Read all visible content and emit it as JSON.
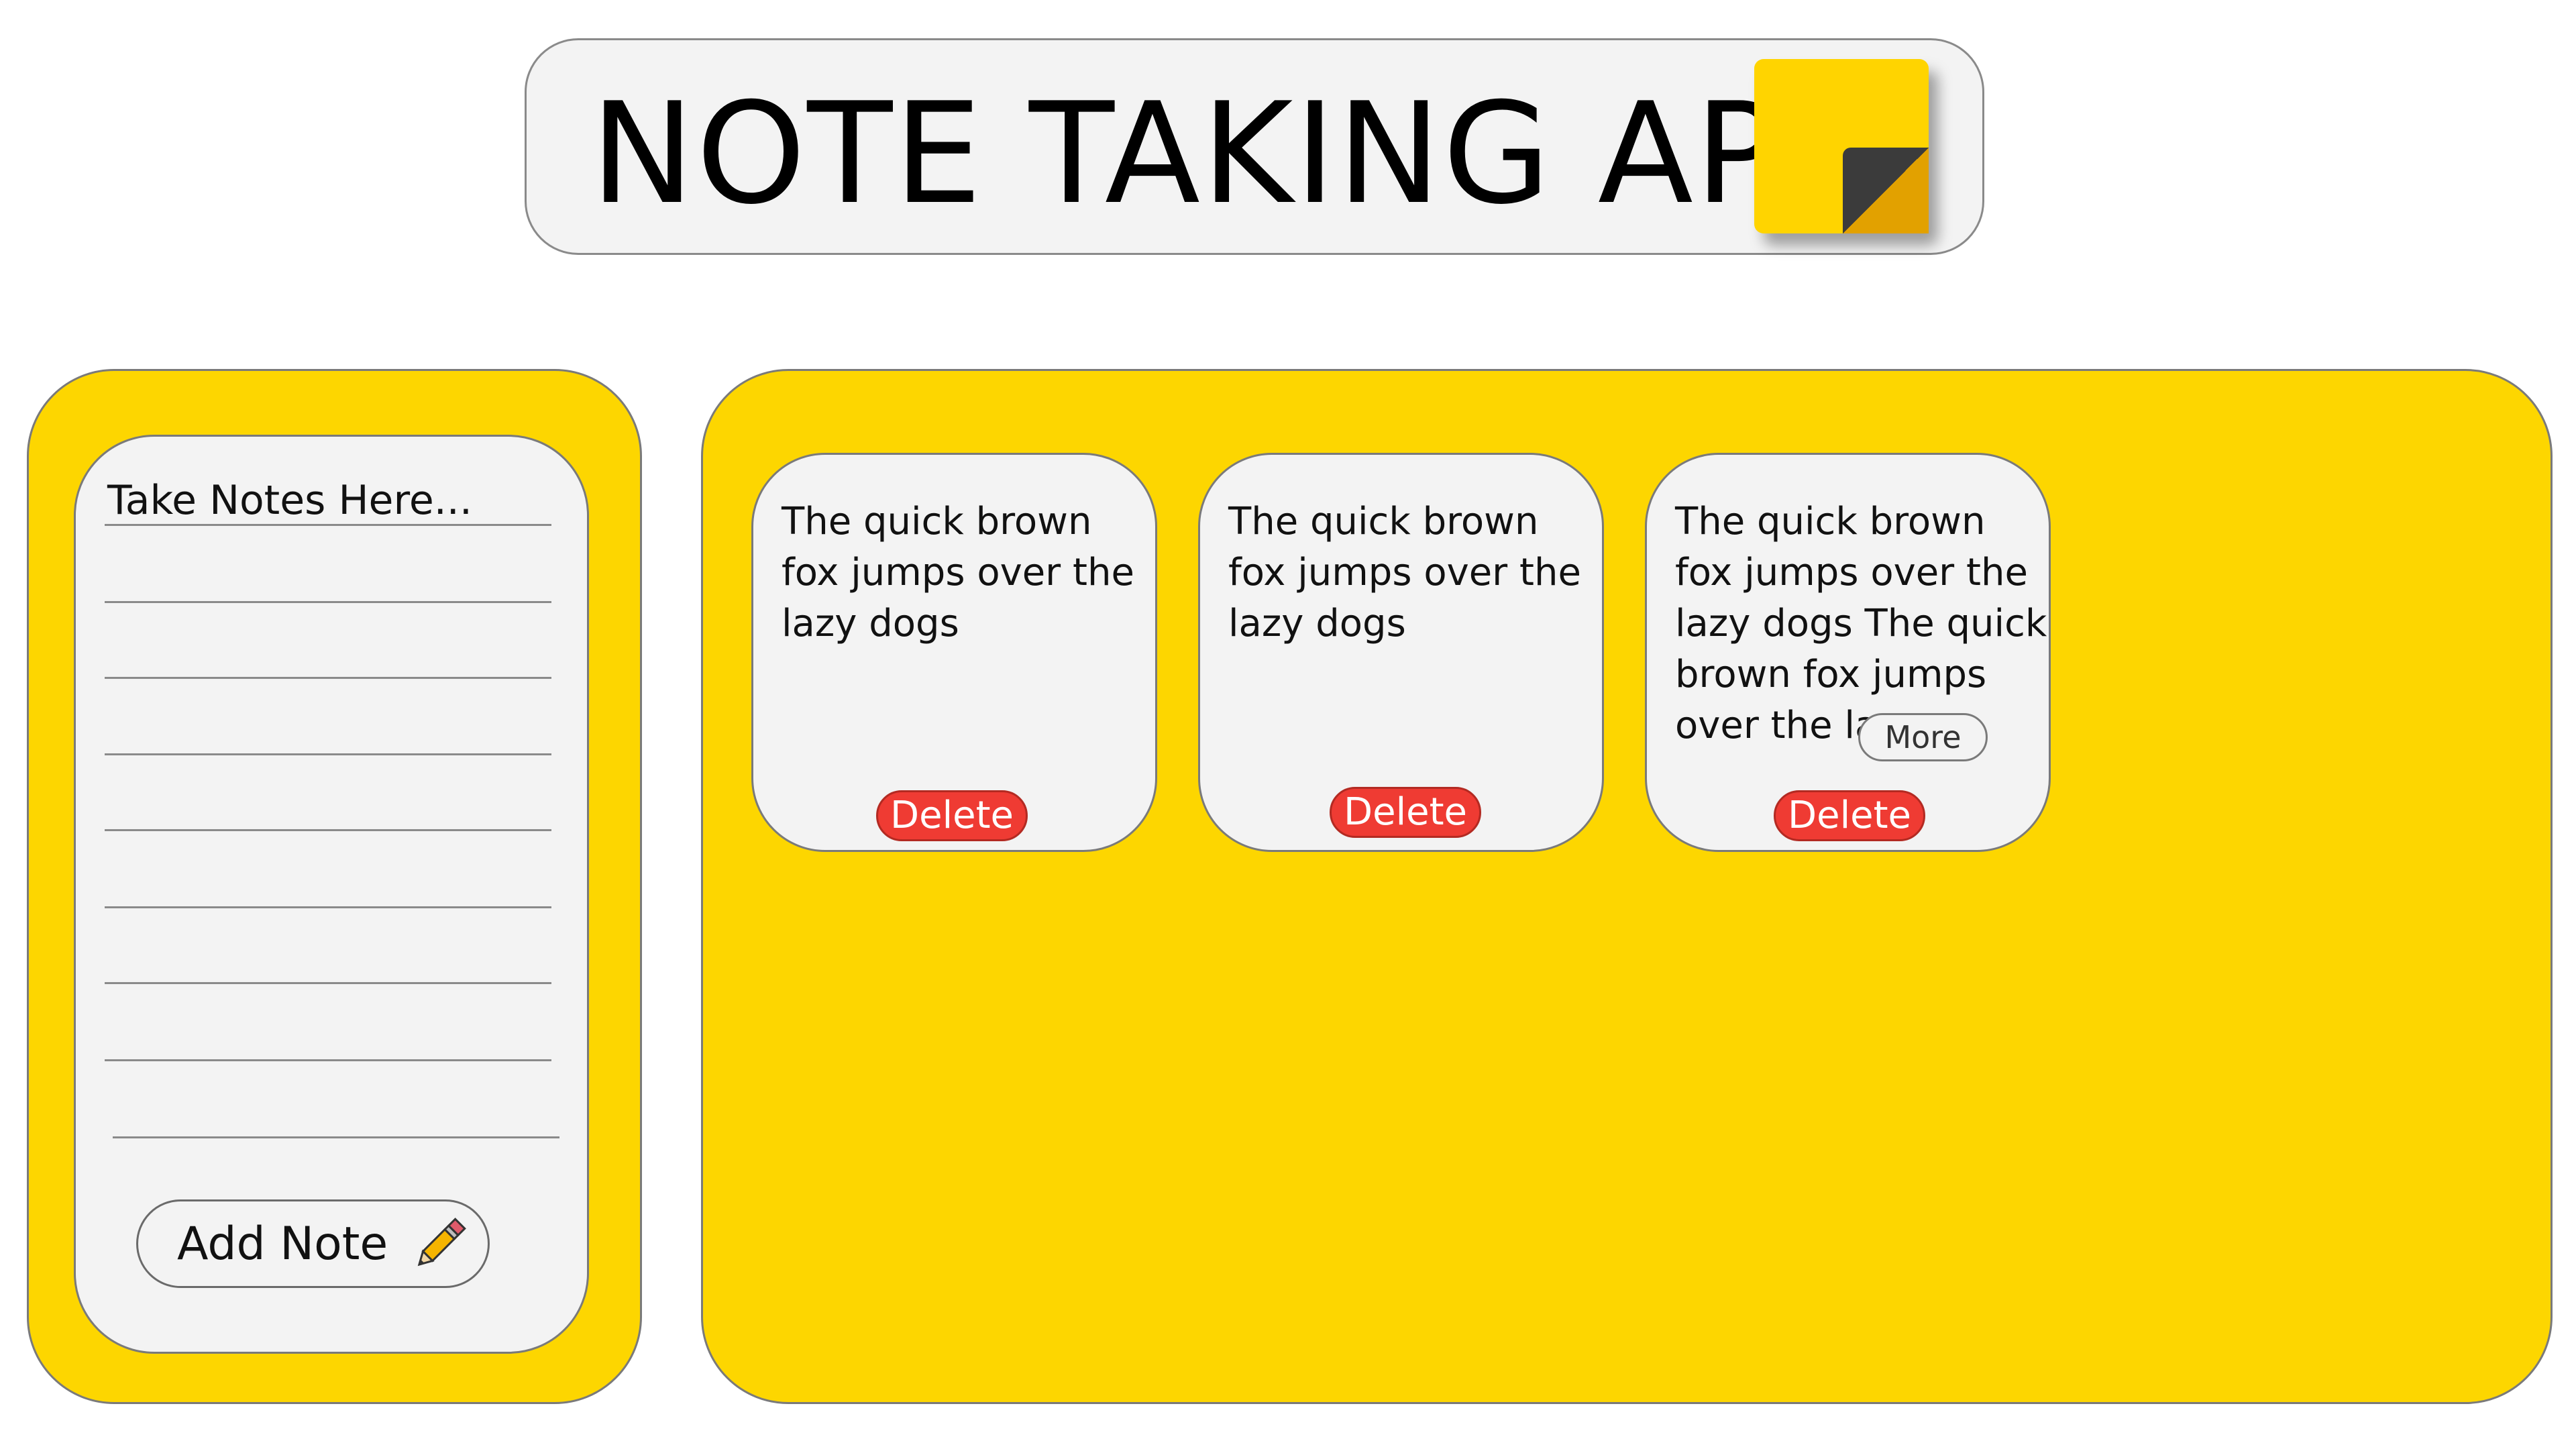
{
  "header": {
    "title": "NOTE TAKING APP",
    "logo_icon": "sticky-note-icon"
  },
  "composer": {
    "placeholder": "Take Notes Here...",
    "add_button_label": "Add Note",
    "add_button_icon": "pencil-icon"
  },
  "notes": [
    {
      "text": "The quick brown fox jumps over the lazy dogs",
      "delete_label": "Delete"
    },
    {
      "text": "The quick brown fox jumps over the lazy dogs",
      "delete_label": "Delete"
    },
    {
      "text": "The quick brown fox jumps over the lazy dogs The quick brown fox jumps over the lazy . .",
      "delete_label": "Delete",
      "more_label": "More"
    }
  ],
  "colors": {
    "panel": "#fdd600",
    "card": "#f3f3f3",
    "delete": "#ef3b33"
  }
}
